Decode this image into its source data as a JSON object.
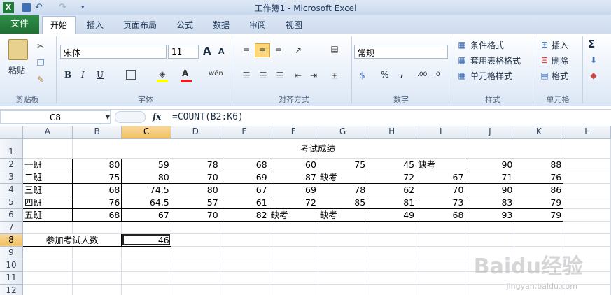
{
  "window": {
    "title": "工作簿1 - Microsoft Excel"
  },
  "tabs": {
    "file": "文件",
    "items": [
      "开始",
      "插入",
      "页面布局",
      "公式",
      "数据",
      "审阅",
      "视图"
    ]
  },
  "ribbon": {
    "clipboard": {
      "paste": "粘贴",
      "label": "剪贴板"
    },
    "font": {
      "name": "宋体",
      "size": "11",
      "label": "字体",
      "bold": "B",
      "italic": "I",
      "underline": "U",
      "grow": "A",
      "shrink": "A",
      "phonetic": "wén",
      "color_a": "A"
    },
    "alignment": {
      "label": "对齐方式"
    },
    "number": {
      "format": "常规",
      "label": "数字",
      "percent": "%",
      "comma": ",",
      "inc": ".00",
      "dec": ".0"
    },
    "styles": {
      "conditional": "条件格式",
      "table": "套用表格格式",
      "cell": "单元格样式",
      "label": "样式"
    },
    "cells": {
      "insert": "插入",
      "delete": "删除",
      "format": "格式",
      "label": "单元格"
    },
    "editing": {
      "sigma": "Σ"
    }
  },
  "formula_bar": {
    "name_box": "C8",
    "fx": "fx",
    "formula": "=COUNT(B2:K6)"
  },
  "columns": [
    "A",
    "B",
    "C",
    "D",
    "E",
    "F",
    "G",
    "H",
    "I",
    "J",
    "K",
    "L"
  ],
  "rows": [
    "1",
    "2",
    "3",
    "4",
    "5",
    "6",
    "7",
    "8",
    "9",
    "10",
    "11",
    "12"
  ],
  "sheet": {
    "header": "考试成绩",
    "data": [
      [
        "一班",
        "80",
        "59",
        "78",
        "68",
        "60",
        "75",
        "45",
        "缺考",
        "90",
        "88"
      ],
      [
        "二班",
        "75",
        "80",
        "70",
        "69",
        "87",
        "缺考",
        "72",
        "67",
        "71",
        "76"
      ],
      [
        "三班",
        "68",
        "74.5",
        "80",
        "67",
        "69",
        "78",
        "62",
        "70",
        "90",
        "86"
      ],
      [
        "四班",
        "76",
        "64.5",
        "57",
        "61",
        "72",
        "85",
        "81",
        "73",
        "83",
        "79"
      ],
      [
        "五班",
        "68",
        "67",
        "70",
        "82",
        "缺考",
        "缺考",
        "49",
        "68",
        "93",
        "79"
      ]
    ],
    "count_label": "参加考试人数",
    "count_value": "46"
  },
  "watermark": {
    "text": "Baidu经验",
    "url": "jingyan.baidu.com"
  },
  "colors": {
    "file_tab": "#2a7d3f",
    "selection": "#d9362f",
    "header_selected": "#f1c15f"
  }
}
